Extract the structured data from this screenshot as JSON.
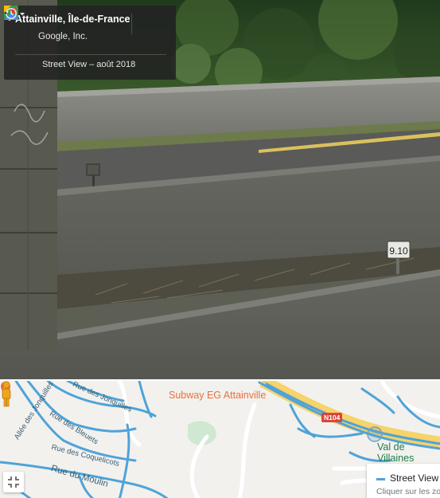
{
  "pano": {
    "title": "Attainville, Île-de-France",
    "publisher": "Google, Inc.",
    "capture_info": "Street View – août 2018",
    "sign_text": "9.10"
  },
  "map": {
    "streets": {
      "allee_jonquilles": "Allée des Jonquilles",
      "rue_jonquilles": "Rue des Jonquilles",
      "rue_bleuets": "Rue des Bleuets",
      "rue_coquelicots": "Rue des Coquelicots",
      "rue_moulin": "Rue du Moulin"
    },
    "poi": "Subway EG Attainville",
    "road_shield": "N104",
    "town": "Val de\nVillaines",
    "legend_title": "Street View",
    "legend_hint": "Cliquer sur les zo"
  },
  "colors": {
    "coverage_blue": "#4fa3d8",
    "highway_yellow": "#f6d36b",
    "poi_orange": "#e8713c",
    "town_green": "#1e7e4a"
  },
  "icons": {
    "maps_logo": "google-maps-icon",
    "pin": "location-pin-icon",
    "more": "more-vertical-icon",
    "history": "history-icon",
    "collapse": "collapse-icon",
    "pegman": "pegman-icon"
  }
}
